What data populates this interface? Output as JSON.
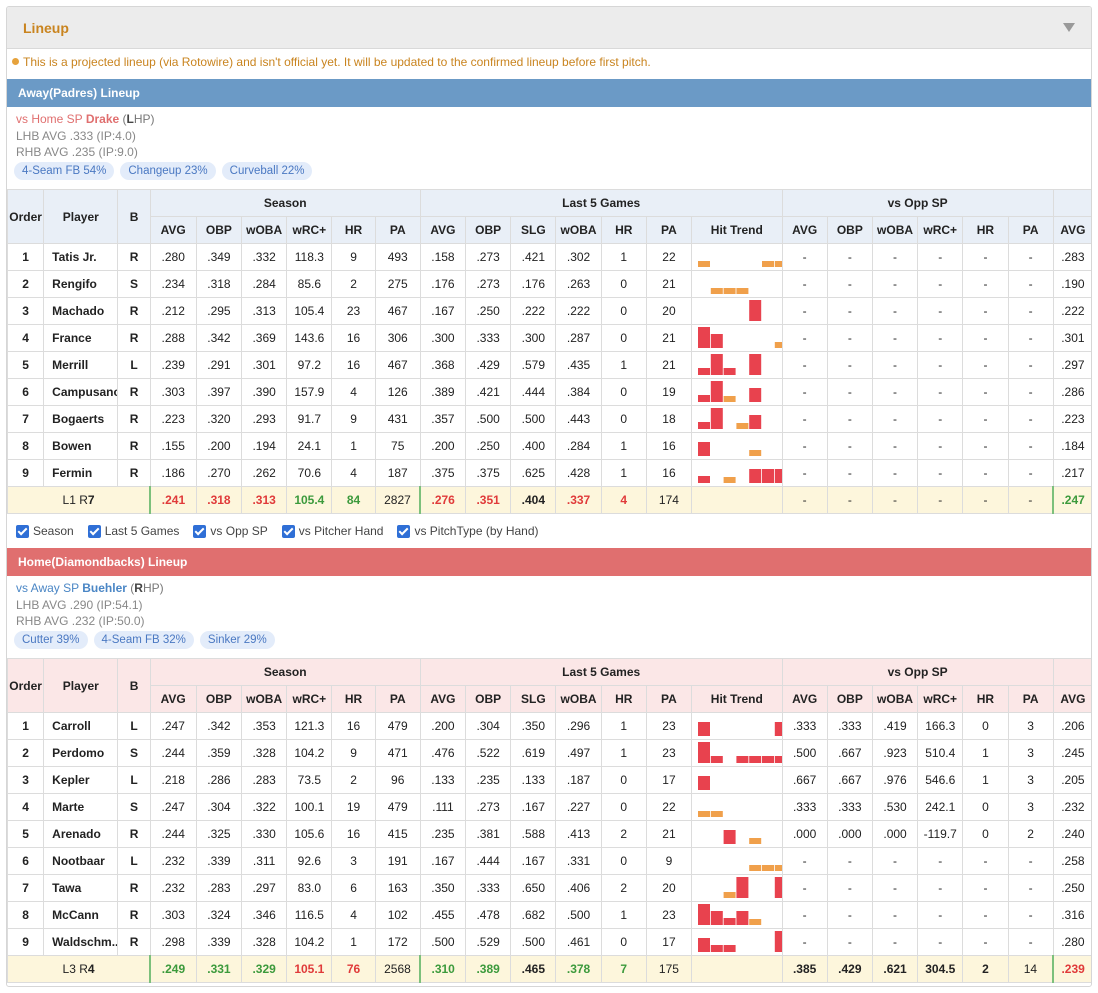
{
  "panel": {
    "title": "Lineup",
    "notice": "This is a projected lineup (via Rotowire) and isn't official yet. It will be updated to the confirmed lineup before first pitch."
  },
  "colors": {
    "accent": "#c9841f",
    "away_bar": "#6b9ac6",
    "home_bar": "#e06f6f",
    "trend_red": "#e8424e",
    "trend_orange": "#f0a04b",
    "good": "#3c9a3c",
    "bad": "#e03a3a"
  },
  "headers": {
    "order": "Order",
    "player": "Player",
    "bats": "B",
    "season": "Season",
    "last5": "Last 5 Games",
    "vs_opp": "vs Opp SP",
    "cols_season": [
      "AVG",
      "OBP",
      "wOBA",
      "wRC+",
      "HR",
      "PA"
    ],
    "cols_last5": [
      "AVG",
      "OBP",
      "SLG",
      "wOBA",
      "HR",
      "PA",
      "Hit Trend"
    ],
    "cols_vs": [
      "AVG",
      "OBP",
      "wOBA",
      "wRC+",
      "HR",
      "PA"
    ],
    "col_extra": "AVG"
  },
  "filters": [
    "Season",
    "Last 5 Games",
    "vs Opp SP",
    "vs Pitcher Hand",
    "vs PitchType (by Hand)"
  ],
  "away": {
    "bar": "Away(Padres) Lineup",
    "sp_prefix": "vs Home SP ",
    "sp_name": "Drake",
    "sp_hand_open": " (",
    "sp_hand_letter": "L",
    "sp_hand_rest": "HP)",
    "lhb": "LHB AVG .333 (IP:4.0)",
    "rhb": "RHB AVG .235 (IP:9.0)",
    "pitches": [
      "4-Seam FB 54%",
      "Changeup 23%",
      "Curveball 22%"
    ],
    "rows": [
      {
        "o": "1",
        "p": "Tatis Jr.",
        "b": "R",
        "s": [
          ".280",
          ".349",
          ".332",
          "118.3",
          "9",
          "493"
        ],
        "l": [
          ".158",
          ".273",
          ".421",
          ".302",
          "1",
          "22"
        ],
        "v": [
          "-",
          "-",
          "-",
          "-",
          "-",
          "-"
        ],
        "x": ".283",
        "t": [
          [
            1,
            "o"
          ],
          [
            0,
            ""
          ],
          [
            0,
            ""
          ],
          [
            0,
            ""
          ],
          [
            0,
            ""
          ],
          [
            1,
            "o"
          ],
          [
            1,
            "o"
          ]
        ]
      },
      {
        "o": "2",
        "p": "Rengifo",
        "b": "S",
        "s": [
          ".234",
          ".318",
          ".284",
          "85.6",
          "2",
          "275"
        ],
        "l": [
          ".176",
          ".273",
          ".176",
          ".263",
          "0",
          "21"
        ],
        "v": [
          "-",
          "-",
          "-",
          "-",
          "-",
          "-"
        ],
        "x": ".190",
        "t": [
          [
            0,
            ""
          ],
          [
            1,
            "o"
          ],
          [
            1,
            "o"
          ],
          [
            1,
            "o"
          ],
          [
            0,
            ""
          ],
          [
            0,
            ""
          ],
          [
            0,
            ""
          ]
        ]
      },
      {
        "o": "3",
        "p": "Machado",
        "b": "R",
        "s": [
          ".212",
          ".295",
          ".313",
          "105.4",
          "23",
          "467"
        ],
        "l": [
          ".167",
          ".250",
          ".222",
          ".222",
          "0",
          "20"
        ],
        "v": [
          "-",
          "-",
          "-",
          "-",
          "-",
          "-"
        ],
        "x": ".222",
        "t": [
          [
            0,
            ""
          ],
          [
            0,
            ""
          ],
          [
            0,
            ""
          ],
          [
            0,
            ""
          ],
          [
            3,
            "r"
          ],
          [
            0,
            ""
          ],
          [
            0,
            ""
          ]
        ]
      },
      {
        "o": "4",
        "p": "France",
        "b": "R",
        "s": [
          ".288",
          ".342",
          ".369",
          "143.6",
          "16",
          "306"
        ],
        "l": [
          ".300",
          ".333",
          ".300",
          ".287",
          "0",
          "21"
        ],
        "v": [
          "-",
          "-",
          "-",
          "-",
          "-",
          "-"
        ],
        "x": ".301",
        "t": [
          [
            3,
            "r"
          ],
          [
            2,
            "r"
          ],
          [
            0,
            ""
          ],
          [
            0,
            ""
          ],
          [
            0,
            ""
          ],
          [
            0,
            ""
          ],
          [
            1,
            "o"
          ]
        ]
      },
      {
        "o": "5",
        "p": "Merrill",
        "b": "L",
        "s": [
          ".239",
          ".291",
          ".301",
          "97.2",
          "16",
          "467"
        ],
        "l": [
          ".368",
          ".429",
          ".579",
          ".435",
          "1",
          "21"
        ],
        "v": [
          "-",
          "-",
          "-",
          "-",
          "-",
          "-"
        ],
        "x": ".297",
        "t": [
          [
            1,
            "r"
          ],
          [
            3,
            "r"
          ],
          [
            1,
            "r"
          ],
          [
            0,
            ""
          ],
          [
            3,
            "r"
          ],
          [
            0,
            ""
          ],
          [
            0,
            ""
          ]
        ]
      },
      {
        "o": "6",
        "p": "Campusano",
        "b": "R",
        "s": [
          ".303",
          ".397",
          ".390",
          "157.9",
          "4",
          "126"
        ],
        "l": [
          ".389",
          ".421",
          ".444",
          ".384",
          "0",
          "19"
        ],
        "v": [
          "-",
          "-",
          "-",
          "-",
          "-",
          "-"
        ],
        "x": ".286",
        "t": [
          [
            1,
            "r"
          ],
          [
            3,
            "r"
          ],
          [
            1,
            "o"
          ],
          [
            0,
            ""
          ],
          [
            2,
            "r"
          ],
          [
            0,
            ""
          ],
          [
            0,
            ""
          ]
        ]
      },
      {
        "o": "7",
        "p": "Bogaerts",
        "b": "R",
        "s": [
          ".223",
          ".320",
          ".293",
          "91.7",
          "9",
          "431"
        ],
        "l": [
          ".357",
          ".500",
          ".500",
          ".443",
          "0",
          "18"
        ],
        "v": [
          "-",
          "-",
          "-",
          "-",
          "-",
          "-"
        ],
        "x": ".223",
        "t": [
          [
            1,
            "r"
          ],
          [
            3,
            "r"
          ],
          [
            0,
            ""
          ],
          [
            1,
            "o"
          ],
          [
            2,
            "r"
          ],
          [
            0,
            ""
          ],
          [
            0,
            ""
          ]
        ]
      },
      {
        "o": "8",
        "p": "Bowen",
        "b": "R",
        "s": [
          ".155",
          ".200",
          ".194",
          "24.1",
          "1",
          "75"
        ],
        "l": [
          ".200",
          ".250",
          ".400",
          ".284",
          "1",
          "16"
        ],
        "v": [
          "-",
          "-",
          "-",
          "-",
          "-",
          "-"
        ],
        "x": ".184",
        "t": [
          [
            2,
            "r"
          ],
          [
            0,
            ""
          ],
          [
            0,
            ""
          ],
          [
            0,
            ""
          ],
          [
            1,
            "o"
          ],
          [
            0,
            ""
          ],
          [
            0,
            ""
          ]
        ]
      },
      {
        "o": "9",
        "p": "Fermin",
        "b": "R",
        "s": [
          ".186",
          ".270",
          ".262",
          "70.6",
          "4",
          "187"
        ],
        "l": [
          ".375",
          ".375",
          ".625",
          ".428",
          "1",
          "16"
        ],
        "v": [
          "-",
          "-",
          "-",
          "-",
          "-",
          "-"
        ],
        "x": ".217",
        "t": [
          [
            1,
            "r"
          ],
          [
            0,
            ""
          ],
          [
            1,
            "o"
          ],
          [
            0,
            ""
          ],
          [
            2,
            "r"
          ],
          [
            2,
            "r"
          ],
          [
            2,
            "r"
          ]
        ]
      }
    ],
    "total": {
      "label_a": "L1 R",
      "label_b": "7",
      "s": [
        ".241",
        ".318",
        ".313",
        "105.4",
        "84",
        "2827"
      ],
      "sc": [
        "r",
        "r",
        "r",
        "g",
        "g",
        "k"
      ],
      "l": [
        ".276",
        ".351",
        ".404",
        ".337",
        "4",
        "174"
      ],
      "lc": [
        "r",
        "r",
        "k",
        "r",
        "r",
        "k"
      ],
      "v": [
        "-",
        "-",
        "-",
        "-",
        "-",
        "-"
      ],
      "x": ".247",
      "xc": "g"
    }
  },
  "home": {
    "bar": "Home(Diamondbacks) Lineup",
    "sp_prefix": "vs Away SP ",
    "sp_name": "Buehler",
    "sp_hand_open": " (",
    "sp_hand_letter": "R",
    "sp_hand_rest": "HP)",
    "lhb": "LHB AVG .290 (IP:54.1)",
    "rhb": "RHB AVG .232 (IP:50.0)",
    "pitches": [
      "Cutter 39%",
      "4-Seam FB 32%",
      "Sinker 29%"
    ],
    "rows": [
      {
        "o": "1",
        "p": "Carroll",
        "b": "L",
        "s": [
          ".247",
          ".342",
          ".353",
          "121.3",
          "16",
          "479"
        ],
        "l": [
          ".200",
          ".304",
          ".350",
          ".296",
          "1",
          "23"
        ],
        "v": [
          ".333",
          ".333",
          ".419",
          "166.3",
          "0",
          "3"
        ],
        "x": ".206",
        "t": [
          [
            2,
            "r"
          ],
          [
            0,
            ""
          ],
          [
            0,
            ""
          ],
          [
            0,
            ""
          ],
          [
            0,
            ""
          ],
          [
            0,
            ""
          ],
          [
            2,
            "r"
          ]
        ]
      },
      {
        "o": "2",
        "p": "Perdomo",
        "b": "S",
        "s": [
          ".244",
          ".359",
          ".328",
          "104.2",
          "9",
          "471"
        ],
        "l": [
          ".476",
          ".522",
          ".619",
          ".497",
          "1",
          "23"
        ],
        "v": [
          ".500",
          ".667",
          ".923",
          "510.4",
          "1",
          "3"
        ],
        "x": ".245",
        "t": [
          [
            3,
            "r"
          ],
          [
            1,
            "r"
          ],
          [
            0,
            ""
          ],
          [
            1,
            "r"
          ],
          [
            1,
            "r"
          ],
          [
            1,
            "r"
          ],
          [
            1,
            "r"
          ]
        ]
      },
      {
        "o": "3",
        "p": "Kepler",
        "b": "L",
        "s": [
          ".218",
          ".286",
          ".283",
          "73.5",
          "2",
          "96"
        ],
        "l": [
          ".133",
          ".235",
          ".133",
          ".187",
          "0",
          "17"
        ],
        "v": [
          ".667",
          ".667",
          ".976",
          "546.6",
          "1",
          "3"
        ],
        "x": ".205",
        "t": [
          [
            2,
            "r"
          ],
          [
            0,
            ""
          ],
          [
            0,
            ""
          ],
          [
            0,
            ""
          ],
          [
            0,
            ""
          ],
          [
            0,
            ""
          ],
          [
            0,
            ""
          ]
        ]
      },
      {
        "o": "4",
        "p": "Marte",
        "b": "S",
        "s": [
          ".247",
          ".304",
          ".322",
          "100.1",
          "19",
          "479"
        ],
        "l": [
          ".111",
          ".273",
          ".167",
          ".227",
          "0",
          "22"
        ],
        "v": [
          ".333",
          ".333",
          ".530",
          "242.1",
          "0",
          "3"
        ],
        "x": ".232",
        "t": [
          [
            1,
            "o"
          ],
          [
            1,
            "o"
          ],
          [
            0,
            ""
          ],
          [
            0,
            ""
          ],
          [
            0,
            ""
          ],
          [
            0,
            ""
          ],
          [
            0,
            ""
          ]
        ]
      },
      {
        "o": "5",
        "p": "Arenado",
        "b": "R",
        "s": [
          ".244",
          ".325",
          ".330",
          "105.6",
          "16",
          "415"
        ],
        "l": [
          ".235",
          ".381",
          ".588",
          ".413",
          "2",
          "21"
        ],
        "v": [
          ".000",
          ".000",
          ".000",
          "-119.7",
          "0",
          "2"
        ],
        "x": ".240",
        "t": [
          [
            0,
            ""
          ],
          [
            0,
            ""
          ],
          [
            2,
            "r"
          ],
          [
            0,
            ""
          ],
          [
            1,
            "o"
          ],
          [
            0,
            ""
          ],
          [
            0,
            ""
          ]
        ]
      },
      {
        "o": "6",
        "p": "Nootbaar",
        "b": "L",
        "s": [
          ".232",
          ".339",
          ".311",
          "92.6",
          "3",
          "191"
        ],
        "l": [
          ".167",
          ".444",
          ".167",
          ".331",
          "0",
          "9"
        ],
        "v": [
          "-",
          "-",
          "-",
          "-",
          "-",
          "-"
        ],
        "x": ".258",
        "t": [
          [
            0,
            ""
          ],
          [
            0,
            ""
          ],
          [
            0,
            ""
          ],
          [
            0,
            ""
          ],
          [
            1,
            "o"
          ],
          [
            1,
            "o"
          ],
          [
            1,
            "o"
          ]
        ]
      },
      {
        "o": "7",
        "p": "Tawa",
        "b": "R",
        "s": [
          ".232",
          ".283",
          ".297",
          "83.0",
          "6",
          "163"
        ],
        "l": [
          ".350",
          ".333",
          ".650",
          ".406",
          "2",
          "20"
        ],
        "v": [
          "-",
          "-",
          "-",
          "-",
          "-",
          "-"
        ],
        "x": ".250",
        "t": [
          [
            0,
            ""
          ],
          [
            0,
            ""
          ],
          [
            1,
            "o"
          ],
          [
            3,
            "r"
          ],
          [
            0,
            ""
          ],
          [
            0,
            ""
          ],
          [
            3,
            "r"
          ]
        ]
      },
      {
        "o": "8",
        "p": "McCann",
        "b": "R",
        "s": [
          ".303",
          ".324",
          ".346",
          "116.5",
          "4",
          "102"
        ],
        "l": [
          ".455",
          ".478",
          ".682",
          ".500",
          "1",
          "23"
        ],
        "v": [
          "-",
          "-",
          "-",
          "-",
          "-",
          "-"
        ],
        "x": ".316",
        "t": [
          [
            3,
            "r"
          ],
          [
            2,
            "r"
          ],
          [
            1,
            "r"
          ],
          [
            2,
            "r"
          ],
          [
            1,
            "o"
          ],
          [
            0,
            ""
          ],
          [
            0,
            ""
          ]
        ]
      },
      {
        "o": "9",
        "p": "Waldschm...",
        "b": "R",
        "s": [
          ".298",
          ".339",
          ".328",
          "104.2",
          "1",
          "172"
        ],
        "l": [
          ".500",
          ".529",
          ".500",
          ".461",
          "0",
          "17"
        ],
        "v": [
          "-",
          "-",
          "-",
          "-",
          "-",
          "-"
        ],
        "x": ".280",
        "t": [
          [
            2,
            "r"
          ],
          [
            1,
            "r"
          ],
          [
            1,
            "r"
          ],
          [
            0,
            ""
          ],
          [
            0,
            ""
          ],
          [
            0,
            ""
          ],
          [
            3,
            "r"
          ]
        ]
      }
    ],
    "total": {
      "label_a": "L3 R",
      "label_b": "4",
      "s": [
        ".249",
        ".331",
        ".329",
        "105.1",
        "76",
        "2568"
      ],
      "sc": [
        "g",
        "g",
        "g",
        "r",
        "r",
        "k"
      ],
      "l": [
        ".310",
        ".389",
        ".465",
        ".378",
        "7",
        "175"
      ],
      "lc": [
        "g",
        "g",
        "k",
        "g",
        "g",
        "k"
      ],
      "v": [
        ".385",
        ".429",
        ".621",
        "304.5",
        "2",
        "14"
      ],
      "vc": [
        "k",
        "k",
        "k",
        "k",
        "k",
        "k"
      ],
      "x": ".239",
      "xc": "r"
    }
  }
}
